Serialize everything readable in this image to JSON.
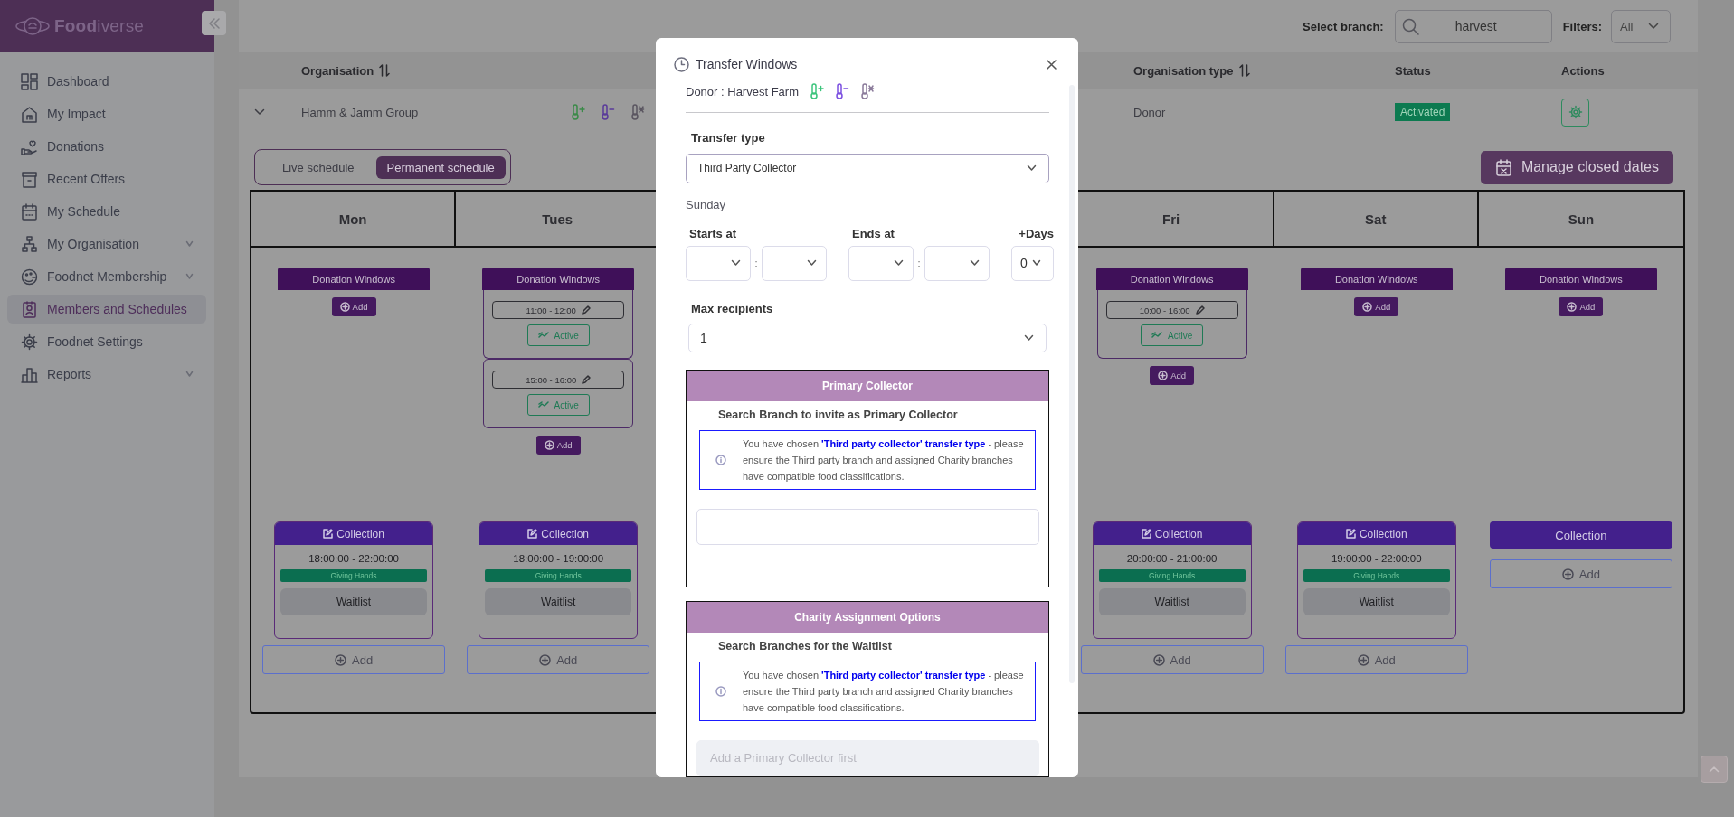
{
  "sidebar": {
    "logo": "**Food**iverse",
    "items": [
      {
        "label": "Dashboard",
        "selected": false,
        "has_submenu": false
      },
      {
        "label": "My Impact",
        "selected": false,
        "has_submenu": false
      },
      {
        "label": "Donations",
        "selected": false,
        "has_submenu": false
      },
      {
        "label": "Recent Offers",
        "selected": false,
        "has_submenu": false
      },
      {
        "label": "My Schedule",
        "selected": false,
        "has_submenu": false
      },
      {
        "label": "My Organisation",
        "selected": false,
        "has_submenu": true
      },
      {
        "label": "Foodnet Membership",
        "selected": false,
        "has_submenu": true
      },
      {
        "label": "Members and Schedules",
        "selected": true,
        "has_submenu": false
      },
      {
        "label": "Foodnet Settings",
        "selected": false,
        "has_submenu": false
      },
      {
        "label": "Reports",
        "selected": false,
        "has_submenu": true
      }
    ]
  },
  "topbar": {
    "branch_label": "Select branch:",
    "search_value": "harvest",
    "filters_label": "Filters:",
    "filter_value": "All"
  },
  "org_table": {
    "columns": [
      {
        "label": "Organisation",
        "sortable": true
      },
      {
        "label": "Organisation type",
        "sortable": true
      },
      {
        "label": "Status",
        "sortable": false
      },
      {
        "label": "Actions",
        "sortable": false
      }
    ],
    "rows": [
      {
        "expanded": true,
        "organisation": "Hamm & Jamm Group",
        "organisation_type": "Donor",
        "status": "Activated"
      }
    ]
  },
  "schedule": {
    "tabs": [
      {
        "label": "Live schedule",
        "selected": false
      },
      {
        "label": "Permanent schedule",
        "selected": true
      }
    ],
    "manage_button": "Manage closed dates",
    "days": [
      {
        "name": "Mon",
        "donation_windows": {
          "title": "Donation Windows",
          "add": "Add"
        },
        "collection": {
          "kind": "assigned",
          "title": "Collection",
          "time": "18:00:00 - 22:00:00",
          "charity": "Giving Hands",
          "waitlist": "Waitlist"
        },
        "add": "Add"
      },
      {
        "name": "Tues",
        "donation_windows": {
          "title": "Donation Windows",
          "windows": [
            {
              "time": "11:00 - 12:00",
              "status": "Active"
            },
            {
              "time": "15:00 - 16:00",
              "status": "Active"
            }
          ],
          "add": "Add"
        },
        "collection": {
          "kind": "assigned",
          "title": "Collection",
          "time": "18:00:00 - 19:00:00",
          "charity": "Giving Hands",
          "waitlist": "Waitlist"
        },
        "add": "Add"
      },
      {
        "name": "Fri",
        "donation_windows": {
          "title": "Donation Windows",
          "windows": [
            {
              "time": "10:00 - 16:00",
              "status": "Active"
            }
          ],
          "add": "Add"
        },
        "collection": {
          "kind": "assigned",
          "title": "Collection",
          "time": "20:00:00 - 21:00:00",
          "charity": "Giving Hands",
          "waitlist": "Waitlist"
        },
        "add": "Add"
      },
      {
        "name": "Sat",
        "donation_windows": {
          "title": "Donation Windows",
          "add": "Add"
        },
        "collection": {
          "kind": "assigned",
          "title": "Collection",
          "time": "19:00:00 - 22:00:00",
          "charity": "Giving Hands",
          "waitlist": "Waitlist"
        },
        "add": "Add"
      },
      {
        "name": "Sun",
        "donation_windows": {
          "title": "Donation Windows",
          "add": "Add"
        },
        "collection": {
          "kind": "unassigned",
          "title": "Collection"
        },
        "add": "Add"
      }
    ]
  },
  "modal": {
    "title": "Transfer Windows",
    "donor": "Donor : Harvest Farm",
    "transfer_type": {
      "label": "Transfer type",
      "value": "Third Party Collector"
    },
    "day": "Sunday",
    "time_separator": ":",
    "starts_label": "Starts at",
    "ends_label": "Ends at",
    "days_label": "+Days",
    "days_value": "0",
    "max_recipients": {
      "label": "Max recipients",
      "value": "1"
    },
    "sections": [
      {
        "title": "Primary Collector",
        "subtitle": "Search Branch to invite as Primary Collector",
        "notice": "You have chosen **'Third party collector' transfer type** - please ensure the Third party branch and assigned Charity branches have compatible food classifications.",
        "field": {
          "disabled": false
        }
      },
      {
        "title": "Charity Assignment Options",
        "subtitle": "Search Branches for the Waitlist",
        "notice": "You have chosen **'Third party collector' transfer type** - please ensure the Third party branch and assigned Charity branches have compatible food classifications.",
        "field": {
          "disabled": true,
          "placeholder": "Add a Primary Collector first"
        }
      }
    ]
  }
}
